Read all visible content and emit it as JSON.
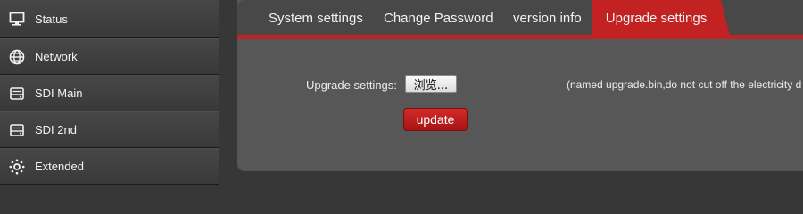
{
  "sidebar": {
    "items": [
      {
        "label": "Status",
        "icon": "monitor-icon"
      },
      {
        "label": "Network",
        "icon": "globe-icon"
      },
      {
        "label": "SDI Main",
        "icon": "drive-icon"
      },
      {
        "label": "SDI 2nd",
        "icon": "drive-icon"
      },
      {
        "label": "Extended",
        "icon": "gear-icon"
      }
    ]
  },
  "tabs": [
    {
      "label": "System settings",
      "active": false
    },
    {
      "label": "Change Password",
      "active": false
    },
    {
      "label": "version info",
      "active": false
    },
    {
      "label": "Upgrade settings",
      "active": true
    }
  ],
  "upgrade": {
    "field_label": "Upgrade settings:",
    "browse_label": "浏览...",
    "hint": "(named upgrade.bin,do not cut off the electricity d",
    "update_label": "update"
  },
  "colors": {
    "accent": "#c22222",
    "sidebar_bg": "#3f3f3f",
    "panel_bg": "#575757"
  }
}
